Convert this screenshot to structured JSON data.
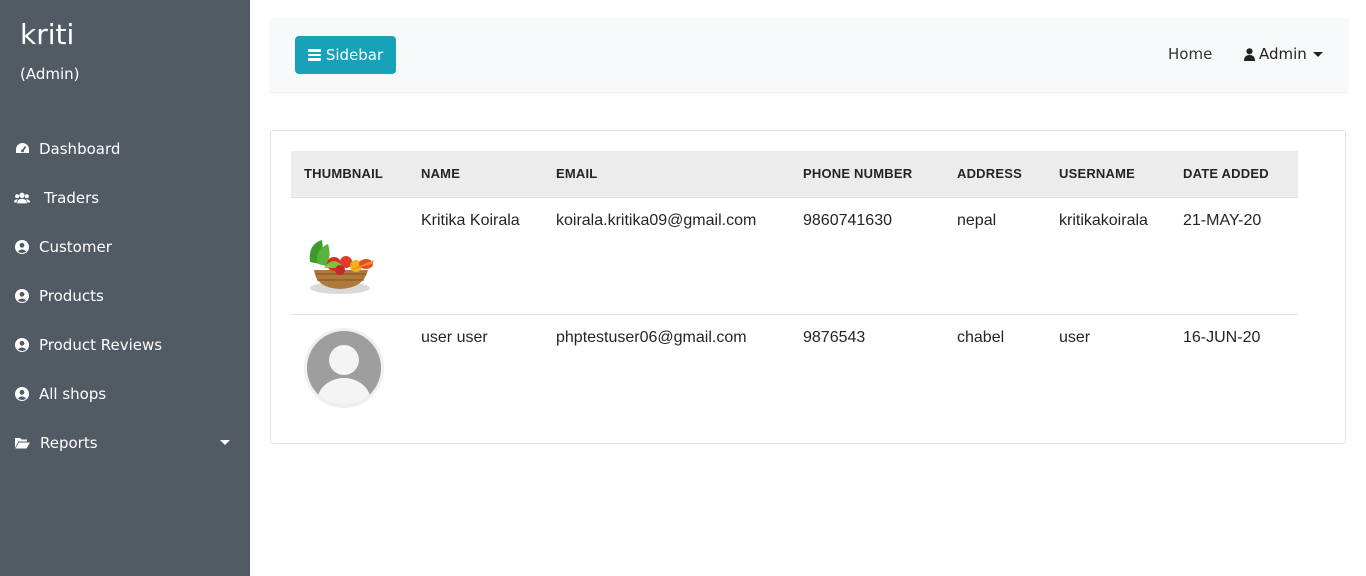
{
  "sidebar": {
    "brand": "kriti",
    "role": "(Admin)",
    "items": [
      {
        "label": "Dashboard",
        "icon": "tachometer-icon"
      },
      {
        "label": "Traders",
        "icon": "users-icon"
      },
      {
        "label": "Customer",
        "icon": "user-circle-icon"
      },
      {
        "label": "Products",
        "icon": "user-circle-icon"
      },
      {
        "label": "Product Reviews",
        "icon": "user-circle-icon"
      },
      {
        "label": "All shops",
        "icon": "user-circle-icon"
      },
      {
        "label": "Reports",
        "icon": "folder-open-icon"
      }
    ]
  },
  "topbar": {
    "sidebar_button": "Sidebar",
    "home": "Home",
    "admin": "Admin"
  },
  "table": {
    "headers": [
      "THUMBNAIL",
      "NAME",
      "EMAIL",
      "PHONE NUMBER",
      "ADDRESS",
      "USERNAME",
      "DATE ADDED"
    ],
    "rows": [
      {
        "thumbnail": "vegetables-basket-image",
        "name": "Kritika Koirala",
        "email": "koirala.kritika09@gmail.com",
        "phone": "9860741630",
        "address": "nepal",
        "username": "kritikakoirala",
        "date": "21-MAY-20"
      },
      {
        "thumbnail": "default-avatar-image",
        "name": "user user",
        "email": "phptestuser06@gmail.com",
        "phone": "9876543",
        "address": "chabel",
        "username": "user",
        "date": "16-JUN-20"
      }
    ]
  },
  "colors": {
    "sidebar_bg": "#525a64",
    "accent": "#17a2b8",
    "topbar_bg": "#f8f9fa",
    "table_header_bg": "#ececec"
  }
}
